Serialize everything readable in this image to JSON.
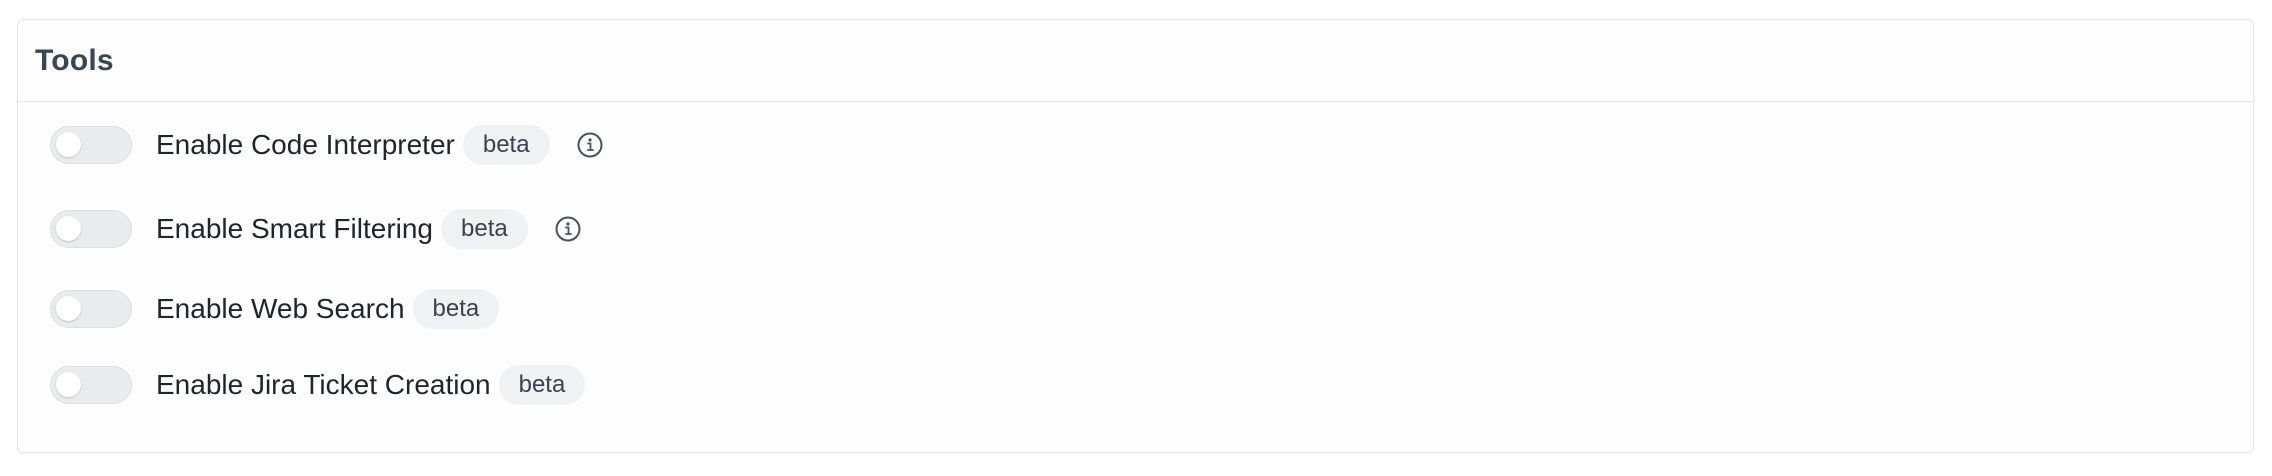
{
  "panel": {
    "title": "Tools"
  },
  "tools": [
    {
      "label": "Enable Code Interpreter",
      "badge": "beta",
      "enabled": false,
      "has_info": true,
      "info_icon": "info-circle-icon"
    },
    {
      "label": "Enable Smart Filtering",
      "badge": "beta",
      "enabled": false,
      "has_info": true,
      "info_icon": "info-circle-icon"
    },
    {
      "label": "Enable Web Search",
      "badge": "beta",
      "enabled": false,
      "has_info": false
    },
    {
      "label": "Enable Jira Ticket Creation",
      "badge": "beta",
      "enabled": false,
      "has_info": false
    }
  ],
  "colors": {
    "toggle_off": "#e9ebee",
    "badge_bg": "#f0f1f3",
    "title": "#3a4456",
    "text": "#1f2430"
  }
}
